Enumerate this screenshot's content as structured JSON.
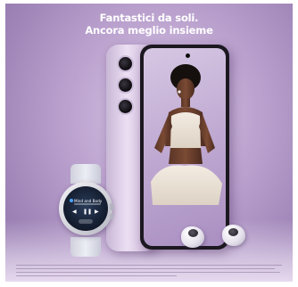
{
  "ad": {
    "headline_line1": "Fantastici da soli.",
    "headline_line2": "Ancora meglio insieme"
  },
  "watch": {
    "track_title": "Mind and Body",
    "icons": [
      "previous-icon",
      "pause-icon",
      "next-icon"
    ]
  },
  "colors": {
    "background": "#b9a0cd",
    "headline": "#ffffff",
    "phone_frame": "#e6d6ee"
  }
}
